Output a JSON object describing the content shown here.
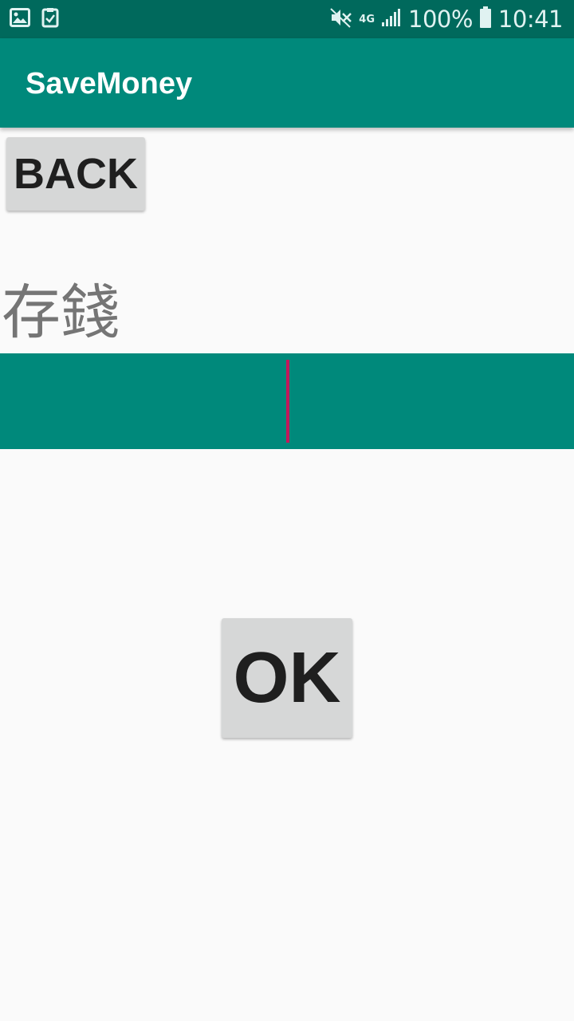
{
  "status_bar": {
    "left_icons": [
      "image-icon",
      "clipboard-check-icon"
    ],
    "right_icons": [
      "mute-icon",
      "signal-icon",
      "battery-icon"
    ],
    "network_label": "4G",
    "battery_text": "100%",
    "time": "10:41"
  },
  "app_bar": {
    "title": "SaveMoney"
  },
  "back_button": {
    "label": "BACK"
  },
  "heading": {
    "text": "存錢"
  },
  "amount_input": {
    "value": ""
  },
  "ok_button": {
    "label": "OK"
  },
  "colors": {
    "status_bar": "#00695c",
    "app_bar": "#00897b",
    "input_background": "#00897b",
    "cursor": "#c2185b",
    "button": "#d6d7d7",
    "background": "#fafafa"
  }
}
